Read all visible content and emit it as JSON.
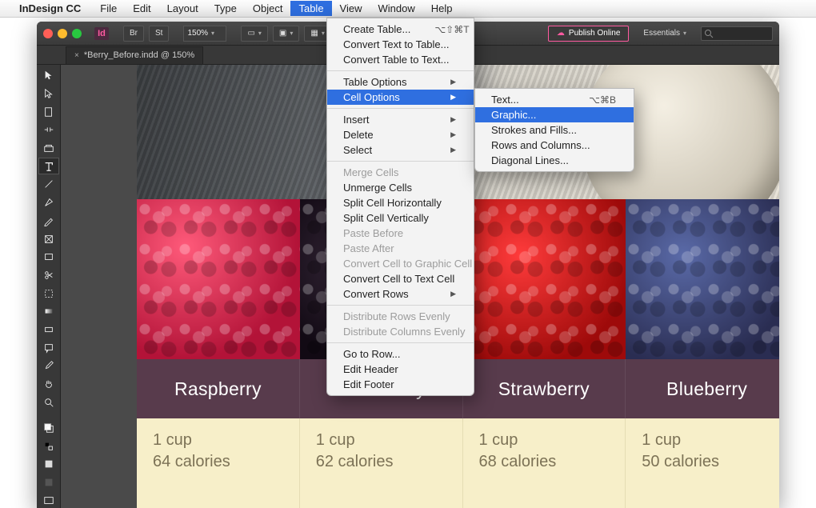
{
  "mac_menu": {
    "app_name": "InDesign CC",
    "items": [
      "File",
      "Edit",
      "Layout",
      "Type",
      "Object",
      "Table",
      "View",
      "Window",
      "Help"
    ],
    "active_index": 5
  },
  "toolbar": {
    "zoom": "150%",
    "publish_label": "Publish Online",
    "workspace": "Essentials"
  },
  "doc_tab": {
    "dirty": "×",
    "name": "*Berry_Before.indd @ 150%"
  },
  "table_menu": {
    "create": "Create Table...",
    "create_shortcut": "⌥⇧⌘T",
    "text_to_table": "Convert Text to Table...",
    "table_to_text": "Convert Table to Text...",
    "table_options": "Table Options",
    "cell_options": "Cell Options",
    "insert": "Insert",
    "delete": "Delete",
    "select": "Select",
    "merge": "Merge Cells",
    "unmerge": "Unmerge Cells",
    "split_h": "Split Cell Horizontally",
    "split_v": "Split Cell Vertically",
    "paste_before": "Paste Before",
    "paste_after": "Paste After",
    "conv_graphic": "Convert Cell to Graphic Cell",
    "conv_text": "Convert Cell to Text Cell",
    "conv_rows": "Convert Rows",
    "dist_rows": "Distribute Rows Evenly",
    "dist_cols": "Distribute Columns Evenly",
    "goto_row": "Go to Row...",
    "edit_header": "Edit Header",
    "edit_footer": "Edit Footer"
  },
  "cell_submenu": {
    "text": "Text...",
    "text_shortcut": "⌥⌘B",
    "graphic": "Graphic...",
    "strokes": "Strokes and Fills...",
    "rows_cols": "Rows and Columns...",
    "diagonal": "Diagonal Lines..."
  },
  "berries": [
    {
      "name": "Raspberry",
      "serving": "1 cup",
      "cal": "64 calories"
    },
    {
      "name": "Blackberry",
      "serving": "1 cup",
      "cal": "62 calories"
    },
    {
      "name": "Strawberry",
      "serving": "1 cup",
      "cal": "68 calories"
    },
    {
      "name": "Blueberry",
      "serving": "1 cup",
      "cal": "50 calories"
    }
  ]
}
